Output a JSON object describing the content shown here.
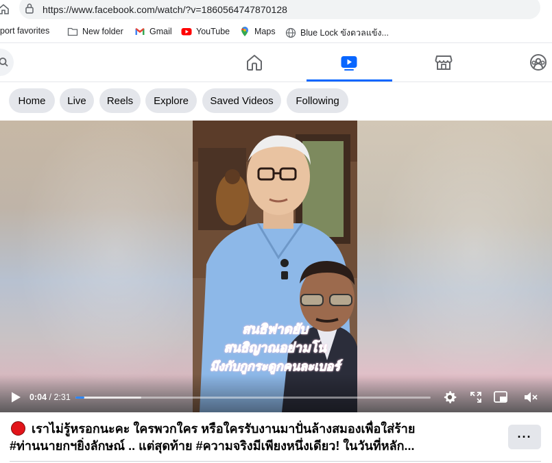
{
  "browser": {
    "url": "https://www.facebook.com/watch/?v=1860564747870128"
  },
  "bookmarks": [
    {
      "label": "port favorites",
      "icon": "none"
    },
    {
      "label": "New folder",
      "icon": "folder-icon"
    },
    {
      "label": "Gmail",
      "icon": "gmail-icon"
    },
    {
      "label": "YouTube",
      "icon": "youtube-icon"
    },
    {
      "label": "Maps",
      "icon": "maps-icon"
    },
    {
      "label": "Blue Lock ขังดวลแข้ง...",
      "icon": "globe-icon"
    }
  ],
  "nav": {
    "items": [
      "home-icon",
      "watch-icon",
      "marketplace-icon",
      "profile-icon"
    ],
    "active": "watch-icon",
    "accent_color": "#0866ff"
  },
  "tabs": [
    "Home",
    "Live",
    "Reels",
    "Explore",
    "Saved Videos",
    "Following"
  ],
  "video": {
    "subtitle_lines": [
      "สนธิฟาดยับ",
      "สนธิญาณอย่ามโน",
      "มึงกับกูกระดูกคนละเบอร์"
    ],
    "time_current": "0:04",
    "time_sep": " / ",
    "time_total": "2:31",
    "progress": 0.026,
    "buffered": 0.185
  },
  "post": {
    "title_line1": "เราไม่รู้หรอกนะคะ ใครพวกใคร หรือใครรับงานมาปั่นล้างสมองเพื่อใส่ร้าย",
    "title_line2": "#ท่านนายกฯยิ่งลักษณ์ .. แต่สุดท้าย #ความจริงมีเพียงหนึ่งเดียว! ในวันที่หลัก...",
    "more_label": "···"
  }
}
